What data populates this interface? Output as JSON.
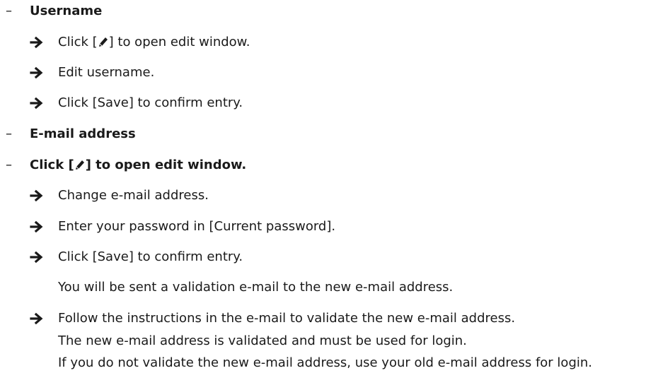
{
  "sections": [
    {
      "dash": "–",
      "title": "Username",
      "steps": [
        {
          "pre": "Click [",
          "icon": "pencil-icon",
          "post": "] to open edit window."
        },
        {
          "text": "Edit username."
        },
        {
          "text": "Click [Save] to confirm entry."
        }
      ]
    },
    {
      "dash": "–",
      "title": "E-mail address"
    },
    {
      "dash": "–",
      "title_pre": "Click [",
      "title_icon": "pencil-icon",
      "title_post": "] to open edit window.",
      "steps": [
        {
          "text": "Change e-mail address."
        },
        {
          "text": "Enter your password in [Current password]."
        },
        {
          "text": "Click [Save] to confirm entry."
        },
        {
          "note": "You will be sent a validation e-mail to the new e-mail address."
        },
        {
          "text": "Follow the instructions in the e-mail to validate the new e-mail address."
        },
        {
          "note": "The new e-mail address is validated and must be used for login."
        },
        {
          "note": "If you do not validate the new e-mail address, use your old e-mail address for login."
        }
      ]
    }
  ],
  "colors": {
    "text": "#1a1a1a",
    "arrow": "#1a1a1a"
  }
}
